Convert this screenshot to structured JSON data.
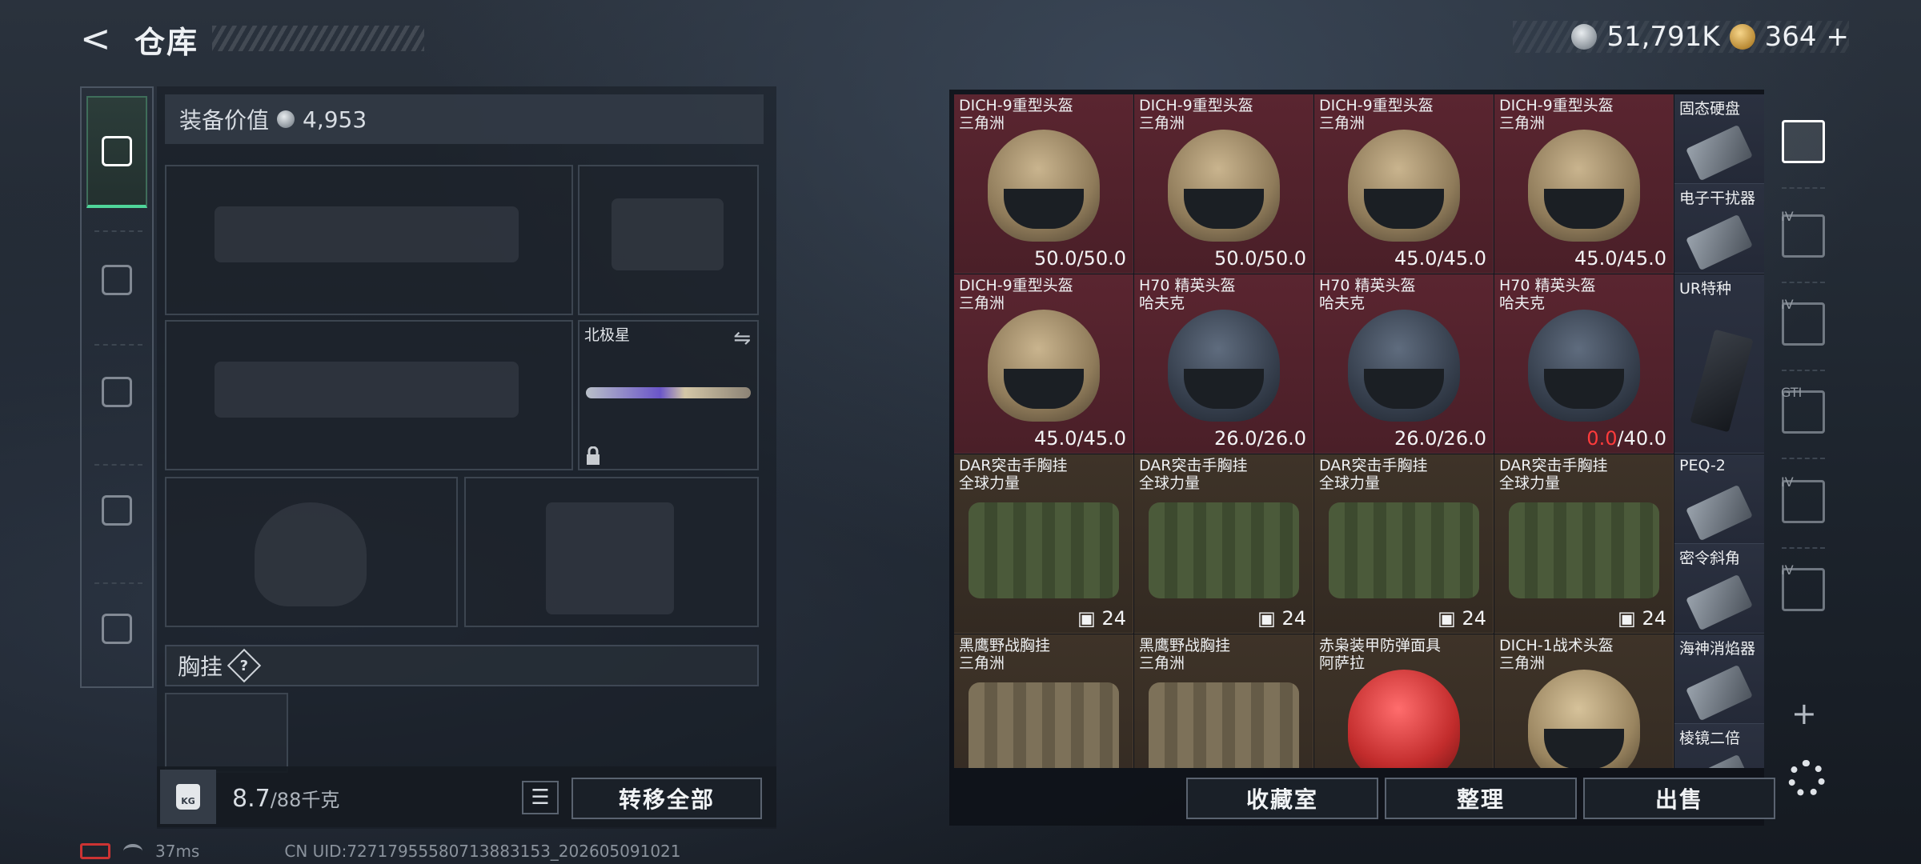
{
  "header": {
    "back_glyph": "<",
    "title": "仓库",
    "currency_silver": "51,791K",
    "currency_gold": "364",
    "currency_gold_plus": "+"
  },
  "left_nav": {
    "items": [
      {
        "id": "weapon",
        "icon": "pistol-icon",
        "active": true
      },
      {
        "id": "armor",
        "icon": "armor-vest-icon",
        "active": false
      },
      {
        "id": "backpack",
        "icon": "backpack-icon",
        "active": false
      },
      {
        "id": "chest-rig",
        "icon": "chest-rig-icon",
        "active": false
      },
      {
        "id": "toolbox",
        "icon": "briefcase-icon",
        "active": false
      }
    ]
  },
  "equipment": {
    "value_label": "装备价值",
    "value": "4,953",
    "melee_slot_label": "北极星",
    "section_chest_label": "胸挂",
    "section_chest_help": "?",
    "weight_current": "8.7",
    "weight_max": "/88千克",
    "weight_icon_text": "KG",
    "transfer_all": "转移全部"
  },
  "warehouse": {
    "grid": [
      {
        "name": "DICH-9重型头盔",
        "sub": "三角洲",
        "dur_cur": "50.0",
        "dur_max": "/50.0",
        "style": "red",
        "art": "tan-helmet"
      },
      {
        "name": "DICH-9重型头盔",
        "sub": "三角洲",
        "dur_cur": "50.0",
        "dur_max": "/50.0",
        "style": "red",
        "art": "tan-helmet"
      },
      {
        "name": "DICH-9重型头盔",
        "sub": "三角洲",
        "dur_cur": "45.0",
        "dur_max": "/45.0",
        "style": "red",
        "art": "tan-helmet"
      },
      {
        "name": "DICH-9重型头盔",
        "sub": "三角洲",
        "dur_cur": "45.0",
        "dur_max": "/45.0",
        "style": "red",
        "art": "tan-helmet"
      },
      {
        "name": "DICH-9重型头盔",
        "sub": "三角洲",
        "dur_cur": "45.0",
        "dur_max": "/45.0",
        "style": "red",
        "art": "tan-helmet"
      },
      {
        "name": "H70 精英头盔",
        "sub": "哈夫克",
        "dur_cur": "26.0",
        "dur_max": "/26.0",
        "style": "red",
        "art": "navy-helmet"
      },
      {
        "name": "H70 精英头盔",
        "sub": "哈夫克",
        "dur_cur": "26.0",
        "dur_max": "/26.0",
        "style": "red",
        "art": "navy-helmet"
      },
      {
        "name": "H70 精英头盔",
        "sub": "哈夫克",
        "dur_cur": "0.0",
        "dur_max": "/40.0",
        "style": "red",
        "art": "navy-helmet",
        "broken": true
      },
      {
        "name": "DAR突击手胸挂",
        "sub": "全球力量",
        "count": "24",
        "style": "brown",
        "art": "green-bag"
      },
      {
        "name": "DAR突击手胸挂",
        "sub": "全球力量",
        "count": "24",
        "style": "brown",
        "art": "green-bag"
      },
      {
        "name": "DAR突击手胸挂",
        "sub": "全球力量",
        "count": "24",
        "style": "brown",
        "art": "green-bag"
      },
      {
        "name": "DAR突击手胸挂",
        "sub": "全球力量",
        "count": "24",
        "style": "brown",
        "art": "green-bag"
      },
      {
        "name": "黑鹰野战胸挂",
        "sub": "三角洲",
        "style": "brown",
        "art": "khaki-bag"
      },
      {
        "name": "黑鹰野战胸挂",
        "sub": "三角洲",
        "style": "brown",
        "art": "khaki-bag"
      },
      {
        "name": "赤枭装甲防弹面具",
        "sub": "阿萨拉",
        "style": "brown",
        "art": "red-helmet"
      },
      {
        "name": "DICH-1战术头盔",
        "sub": "三角洲",
        "style": "brown",
        "art": "sand-helmet"
      }
    ],
    "side_items": [
      {
        "name": "固态硬盘"
      },
      {
        "name": "电子干扰器"
      },
      {
        "name": "UR特种"
      },
      {
        "name": "PEQ-2"
      },
      {
        "name": "密令斜角"
      },
      {
        "name": "海神消焰器"
      },
      {
        "name": "棱镜二倍"
      }
    ],
    "buttons": {
      "collection": "收藏室",
      "sort": "整理",
      "sell": "出售"
    }
  },
  "right_nav": {
    "items": [
      {
        "tag": "",
        "icon": "safe-house-icon",
        "active": true
      },
      {
        "tag": "IV",
        "icon": "storage-case-icon"
      },
      {
        "tag": "IV",
        "icon": "storage-case-icon"
      },
      {
        "tag": "GTI",
        "icon": "storage-case-icon"
      },
      {
        "tag": "IV",
        "icon": "storage-case-icon"
      },
      {
        "tag": "IV",
        "icon": "storage-case-icon"
      }
    ],
    "add": "+"
  },
  "footer": {
    "ping": "37ms",
    "uid": "CN UID:72717955580713883153_202605091021"
  },
  "colors": {
    "accent_green": "#4fd59a",
    "rare_red": "#5a2530",
    "common_brown": "#3e3328",
    "broken_red": "#ff3b3b"
  }
}
